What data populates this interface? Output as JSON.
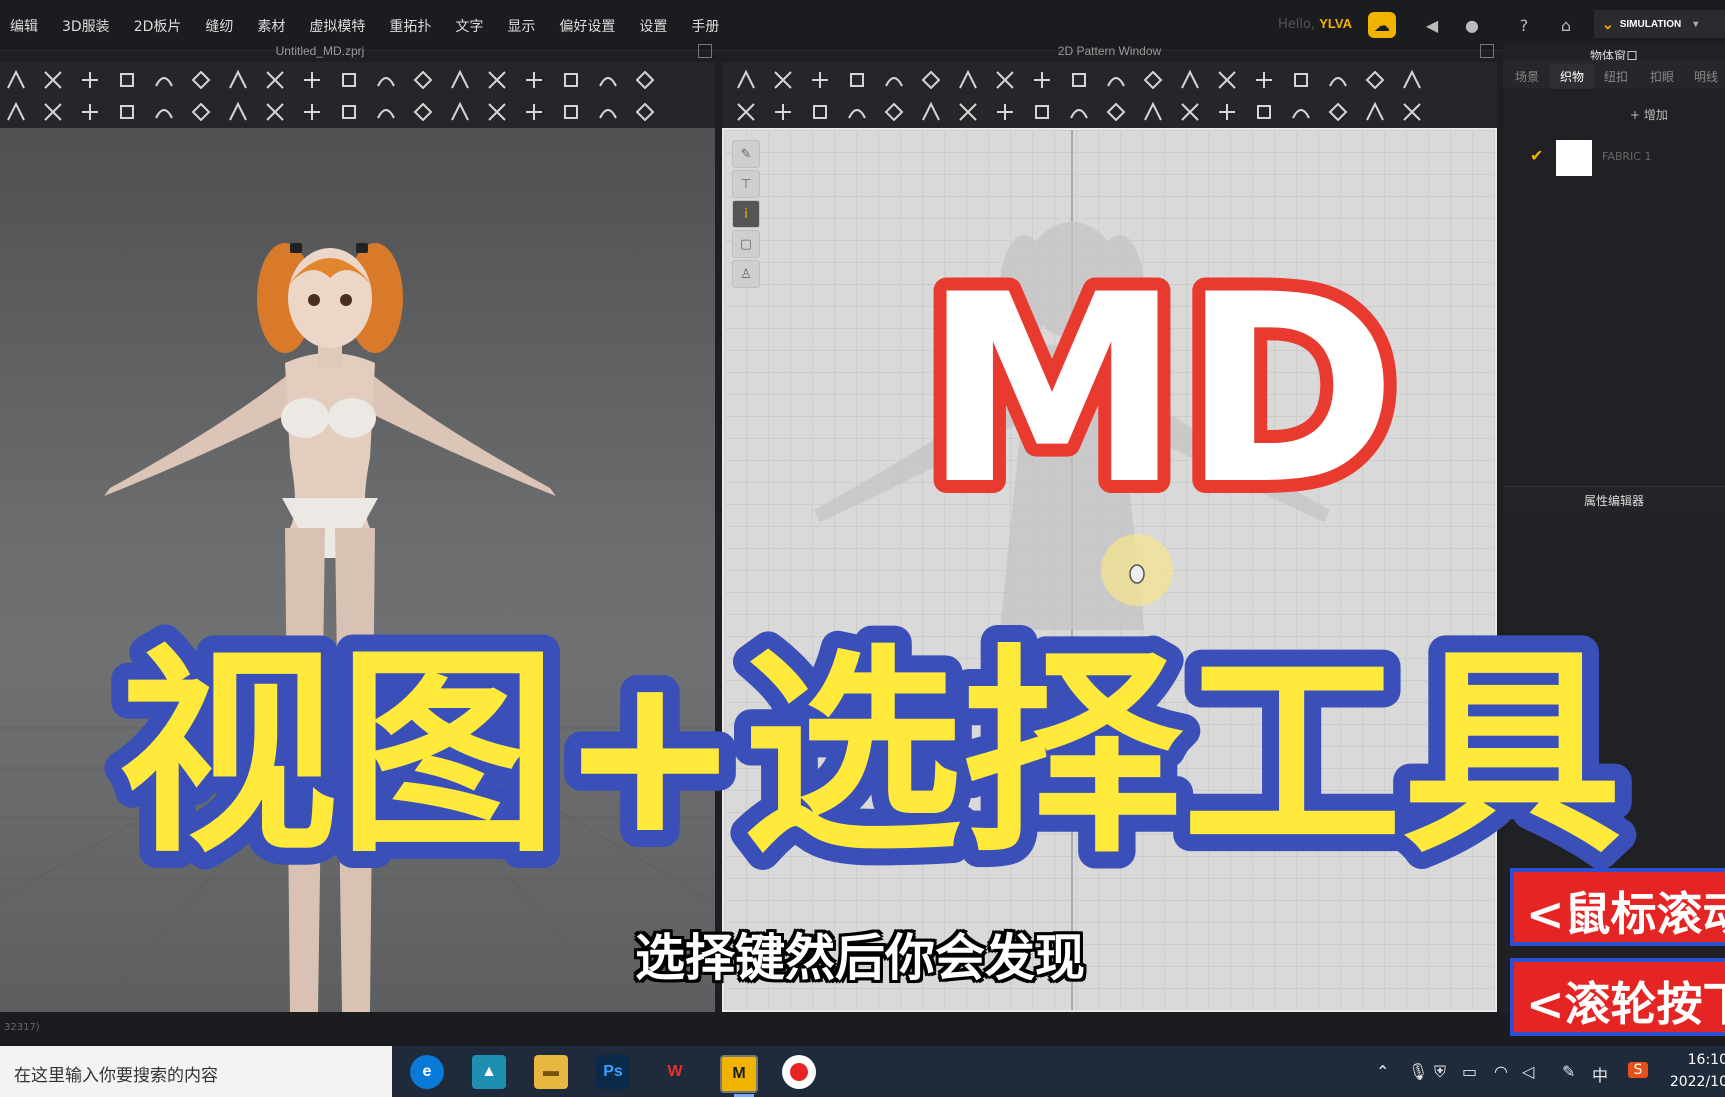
{
  "menu": [
    "编辑",
    "3D服装",
    "2D板片",
    "缝纫",
    "素材",
    "虚拟模特",
    "重拓扑",
    "文字",
    "显示",
    "偏好设置",
    "设置",
    "手册"
  ],
  "user": {
    "hello": "Hello,",
    "name": "YLVA"
  },
  "simulation_label": "SIMULATION",
  "windows": {
    "left_title": "Untitled_MD.zprj",
    "center_title": "2D Pattern Window",
    "right_title": "物体窗口"
  },
  "object_panel": {
    "tabs": [
      "场景",
      "织物",
      "纽扣",
      "扣眼",
      "明线"
    ],
    "active_tab": "织物",
    "add_label": "+ 增加",
    "fabric_name": "FABRIC 1"
  },
  "property_editor_title": "属性编辑器",
  "status_text": "32317)",
  "overlay": {
    "logo": "MD",
    "title": "视图+选择工具",
    "subtitle": "选择键然后你会发现",
    "tag1": "<鼠标滚动",
    "tag2": "<滚轮按下"
  },
  "taskbar": {
    "search_placeholder": "在这里输入你要搜索的内容",
    "time": "16:10",
    "date": "2022/10",
    "ime": "中"
  },
  "colors": {
    "accent": "#f0b400",
    "overlay_yellow": "#ffe93a",
    "overlay_blue": "#3a4fb8",
    "logo_red": "#e83a2e",
    "tag_red": "#e52424"
  }
}
